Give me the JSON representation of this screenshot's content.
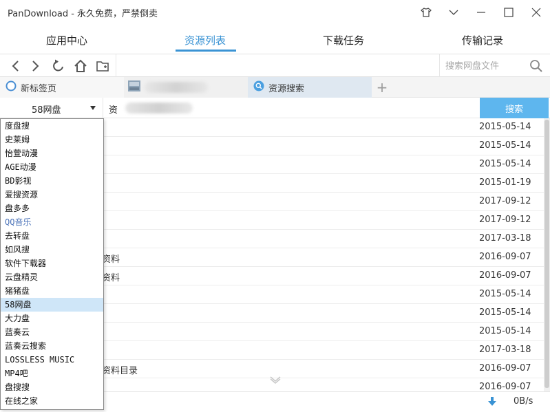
{
  "window": {
    "title": "PanDownload - 永久免费，严禁倒卖"
  },
  "nav": {
    "tabs": [
      "应用中心",
      "资源列表",
      "下载任务",
      "传输记录"
    ],
    "active": "资源列表"
  },
  "toolbar": {
    "search_placeholder": "搜索网盘文件"
  },
  "tabs": [
    {
      "label": "新标签页"
    },
    {
      "label": ""
    },
    {
      "label": "资源搜索",
      "active": true
    }
  ],
  "filter": {
    "selected_source": "58网盘",
    "keyword_prefix": "资",
    "search_button": "搜索"
  },
  "dropdown": {
    "options": [
      "度盘搜",
      "史莱姆",
      "怡萱动漫",
      "AGE动漫",
      "BD影视",
      "爱搜资源",
      "盘多多",
      "QQ音乐",
      "去转盘",
      "如风搜",
      "软件下载器",
      "云盘精灵",
      "猪猪盘",
      "58网盘",
      "大力盘",
      "蓝奏云",
      "蓝奏云搜索",
      "LOSSLESS MUSIC",
      "MP4吧",
      "盘搜搜",
      "在线之家"
    ],
    "selected": "58网盘"
  },
  "results": [
    {
      "name": "",
      "date": "2015-05-14"
    },
    {
      "name": "",
      "date": "2015-05-14"
    },
    {
      "name": "",
      "date": "2015-05-14"
    },
    {
      "name": "",
      "date": "2015-01-19"
    },
    {
      "name": "",
      "date": "2017-09-12"
    },
    {
      "name": "",
      "date": "2017-09-12"
    },
    {
      "name": "",
      "date": "2017-03-18"
    },
    {
      "name": "资料",
      "date": "2016-09-07"
    },
    {
      "name": "资料",
      "date": "2016-09-07"
    },
    {
      "name": "",
      "date": "2015-05-14"
    },
    {
      "name": "",
      "date": "2015-05-14"
    },
    {
      "name": "",
      "date": "2015-05-14"
    },
    {
      "name": "",
      "date": "2017-03-18"
    },
    {
      "name": "资料目录",
      "date": "2016-09-07"
    },
    {
      "name": "",
      "date": "2016-09-07"
    }
  ],
  "status": {
    "speed": "0B/s"
  },
  "colors": {
    "accent": "#3a93d4",
    "search_button": "#5eb6ee",
    "selected_item": "#cfe6f8"
  }
}
